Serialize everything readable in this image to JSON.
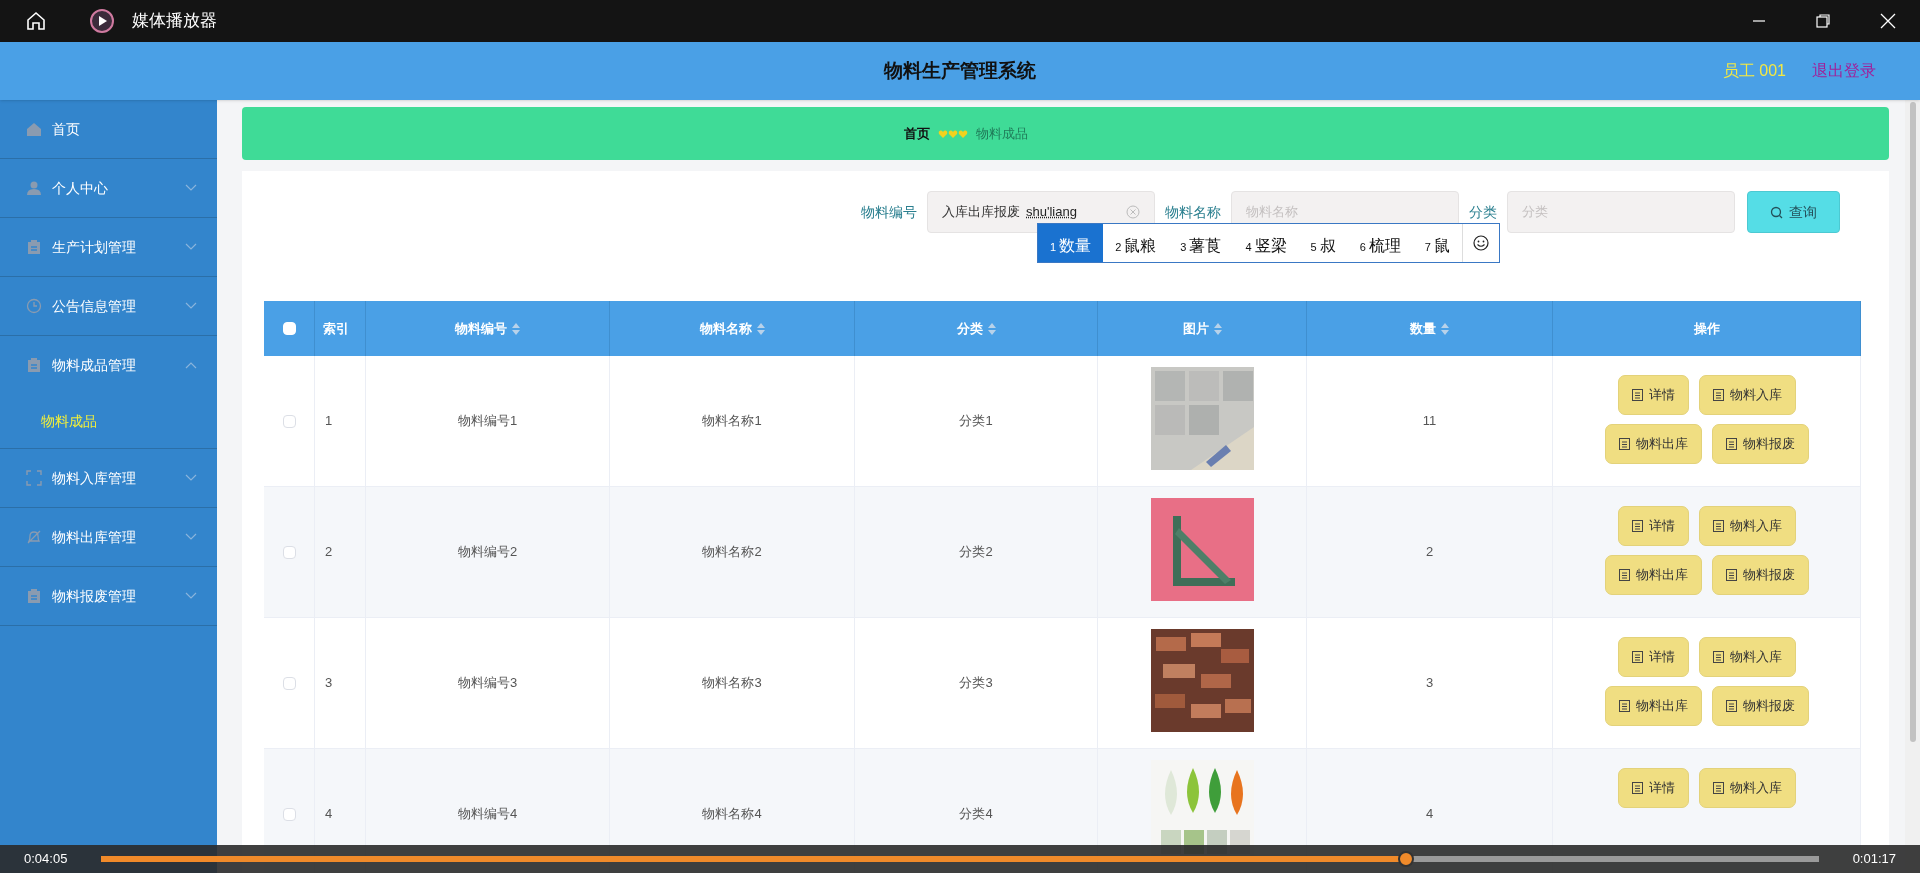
{
  "title_bar": {
    "title": "媒体播放器"
  },
  "header": {
    "title": "物料生产管理系统",
    "user": "员工 001",
    "logout": "退出登录"
  },
  "sidebar": {
    "items": [
      {
        "label": "首页",
        "kind": "home"
      },
      {
        "label": "个人中心",
        "kind": "user",
        "expanded": false
      },
      {
        "label": "生产计划管理",
        "kind": "clipboard",
        "expanded": false
      },
      {
        "label": "公告信息管理",
        "kind": "clock",
        "expanded": false
      },
      {
        "label": "物料成品管理",
        "kind": "clipboard",
        "expanded": true,
        "children": [
          {
            "label": "物料成品",
            "selected": true
          }
        ]
      },
      {
        "label": "物料入库管理",
        "kind": "frame",
        "expanded": false
      },
      {
        "label": "物料出库管理",
        "kind": "bell",
        "expanded": false
      },
      {
        "label": "物料报废管理",
        "kind": "clipboard",
        "expanded": false
      }
    ]
  },
  "breadcrumb": {
    "items": [
      "首页",
      "物料成品"
    ]
  },
  "search": {
    "fields": [
      {
        "label": "物料编号",
        "value": "入库出库报废",
        "composition": "shu'liang"
      },
      {
        "label": "物料名称",
        "placeholder": "物料名称"
      },
      {
        "label": "分类",
        "placeholder": "分类"
      }
    ],
    "button": "查询"
  },
  "ime": {
    "candidates": [
      {
        "index": "1",
        "text": "数量",
        "selected": true
      },
      {
        "index": "2",
        "text": "鼠粮",
        "selected": false
      },
      {
        "index": "3",
        "text": "薯莨",
        "selected": false
      },
      {
        "index": "4",
        "text": "竖梁",
        "selected": false
      },
      {
        "index": "5",
        "text": "叔",
        "selected": false
      },
      {
        "index": "6",
        "text": "梳理",
        "selected": false
      },
      {
        "index": "7",
        "text": "鼠",
        "selected": false
      }
    ]
  },
  "table": {
    "select_all": {
      "checked": false
    },
    "columns": [
      {
        "label": "索引",
        "sortable": false
      },
      {
        "label": "物料编号",
        "sortable": true
      },
      {
        "label": "物料名称",
        "sortable": true
      },
      {
        "label": "分类",
        "sortable": true
      },
      {
        "label": "图片",
        "sortable": true
      },
      {
        "label": "数量",
        "sortable": true
      },
      {
        "label": "操作",
        "sortable": false
      }
    ],
    "rows": [
      {
        "checked": false,
        "index": "1",
        "code": "物料编号1",
        "name": "物料名称1",
        "category": "分类1",
        "quantity": "11",
        "actions": [
          "详情",
          "物料入库",
          "物料出库",
          "物料报废"
        ]
      },
      {
        "checked": false,
        "index": "2",
        "code": "物料编号2",
        "name": "物料名称2",
        "category": "分类2",
        "quantity": "2",
        "actions": [
          "详情",
          "物料入库",
          "物料出库",
          "物料报废"
        ]
      },
      {
        "checked": false,
        "index": "3",
        "code": "物料编号3",
        "name": "物料名称3",
        "category": "分类3",
        "quantity": "3",
        "actions": [
          "详情",
          "物料入库",
          "物料出库",
          "物料报废"
        ]
      },
      {
        "checked": false,
        "index": "4",
        "code": "物料编号4",
        "name": "物料名称4",
        "category": "分类4",
        "quantity": "4",
        "actions": [
          "详情",
          "物料入库"
        ]
      }
    ]
  },
  "player": {
    "elapsed": "0:04:05",
    "remaining": "0:01:17",
    "progress": {
      "level": 0.76
    }
  }
}
